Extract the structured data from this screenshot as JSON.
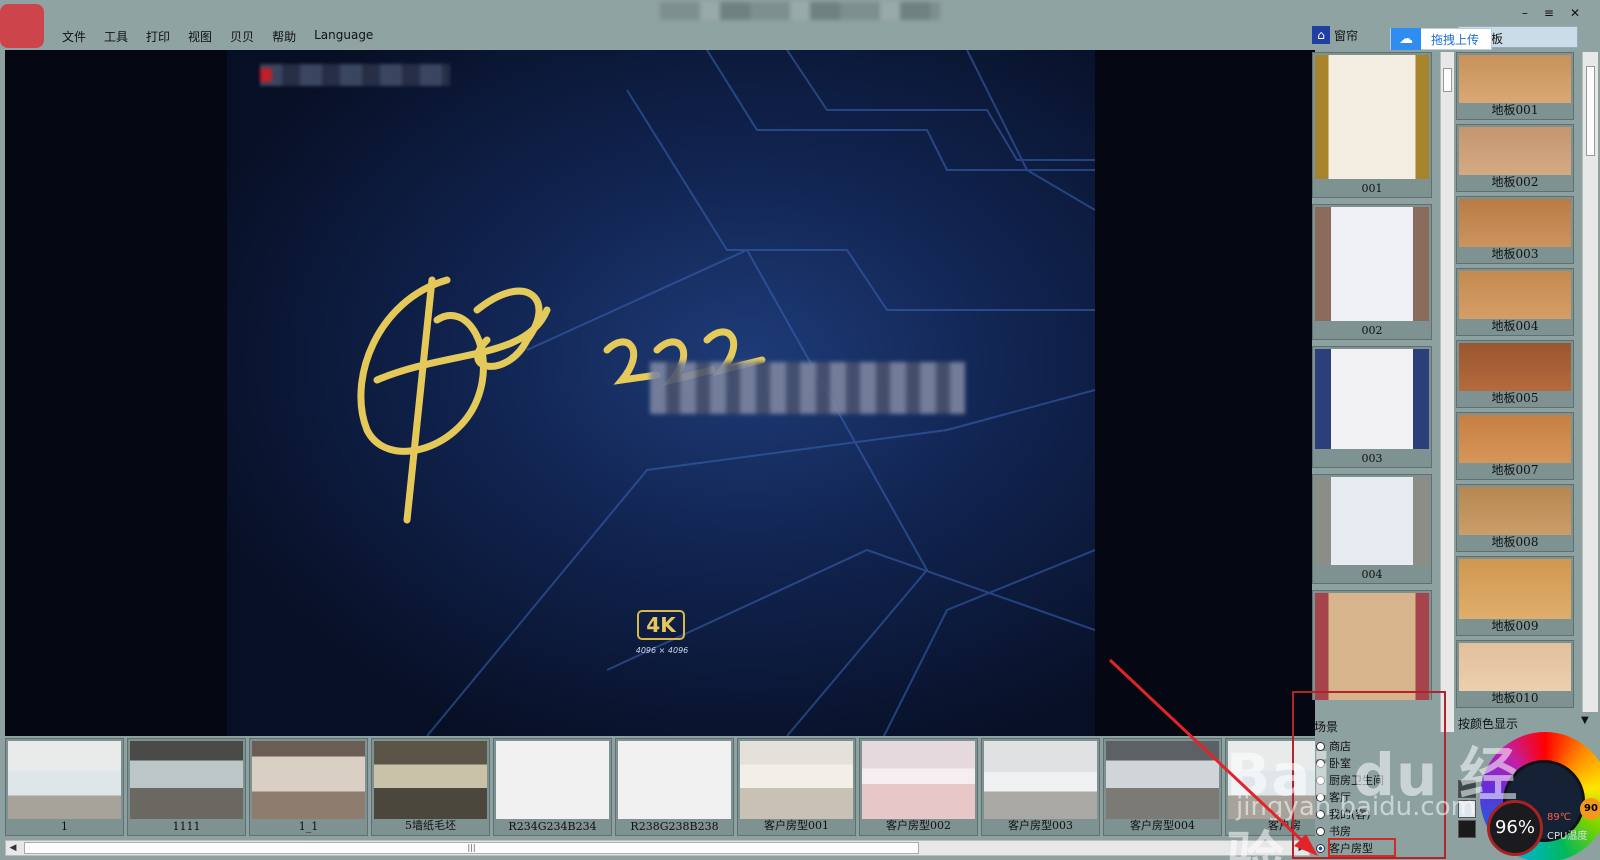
{
  "menu": [
    "文件",
    "工具",
    "打印",
    "视图",
    "贝贝",
    "帮助",
    "Language"
  ],
  "window_controls": [
    "–",
    "≡",
    "✕"
  ],
  "curtain_tab": {
    "label": "窗帘"
  },
  "upload_button": {
    "label": "拖拽上传"
  },
  "floor_tab": {
    "label": "板"
  },
  "poster": {
    "badge": "4K",
    "resolution": "4096 × 4096"
  },
  "thumbnails": [
    "1",
    "1111",
    "1_1",
    "5墙纸毛坯",
    "R234G234B234",
    "R238G238B238",
    "客户房型001",
    "客户房型002",
    "客户房型003",
    "客户房型004",
    "客户房"
  ],
  "curtains": [
    "001",
    "002",
    "003",
    "004",
    ""
  ],
  "floors": [
    "地板001",
    "地板002",
    "地板003",
    "地板004",
    "地板005",
    "地板007",
    "地板008",
    "地板009",
    "地板010"
  ],
  "scene": {
    "title": "场景",
    "options": [
      "商店",
      "卧室",
      "厨房卫生间",
      "客厅",
      "我的(客)",
      "书房",
      "客户房型"
    ],
    "selected": "客户房型"
  },
  "color_panel": {
    "label": "按颜色显示"
  },
  "cpu_widget": {
    "usage": "96%",
    "temperature": "89℃",
    "label": "CPU温度",
    "side": "90"
  },
  "watermark": {
    "brand": "Bai du 经验",
    "url": "jingyan.baidu.com"
  },
  "colors": {
    "accent_red": "#d12a2a",
    "upload_blue": "#1c6fd9",
    "panel_bg": "#8da1a0"
  }
}
